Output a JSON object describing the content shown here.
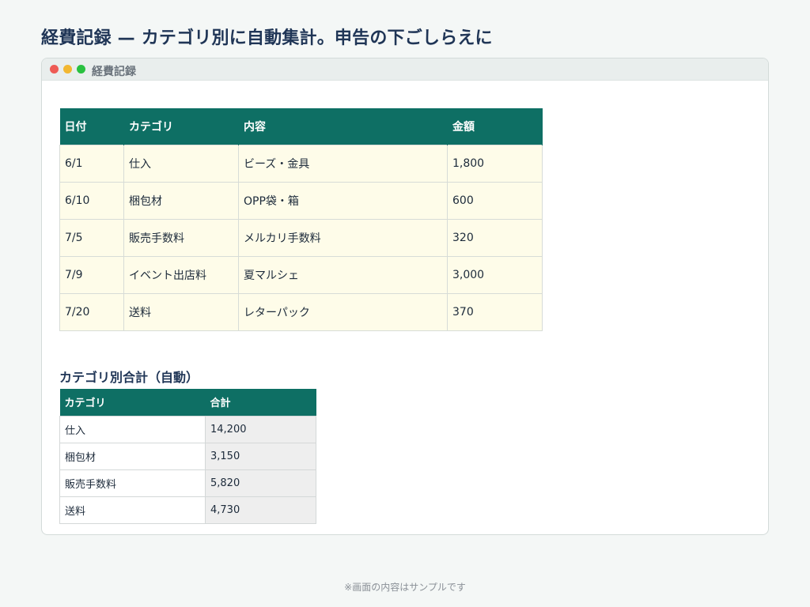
{
  "page_title": "経費記録 — カテゴリ別に自動集計。申告の下ごしらえに",
  "window": {
    "title": "経費記録",
    "controls": [
      "close",
      "minimize",
      "maximize"
    ]
  },
  "expense_table": {
    "headers": [
      "日付",
      "カテゴリ",
      "内容",
      "金額"
    ],
    "rows": [
      [
        "6/1",
        "仕入",
        "ビーズ・金具",
        "1,800"
      ],
      [
        "6/10",
        "梱包材",
        "OPP袋・箱",
        "600"
      ],
      [
        "7/5",
        "販売手数料",
        "メルカリ手数料",
        "320"
      ],
      [
        "7/9",
        "イベント出店料",
        "夏マルシェ",
        "3,000"
      ],
      [
        "7/20",
        "送料",
        "レターパック",
        "370"
      ]
    ]
  },
  "summary": {
    "title": "カテゴリ別合計（自動）",
    "headers": [
      "カテゴリ",
      "合計"
    ],
    "rows": [
      [
        "仕入",
        "14,200"
      ],
      [
        "梱包材",
        "3,150"
      ],
      [
        "販売手数料",
        "5,820"
      ],
      [
        "送料",
        "4,730"
      ]
    ]
  },
  "footnote": "※画面の内容はサンプルです",
  "colors": {
    "header_bg": "#0e6f64",
    "row_bg": "#fefce9",
    "title_color": "#1f3556"
  }
}
